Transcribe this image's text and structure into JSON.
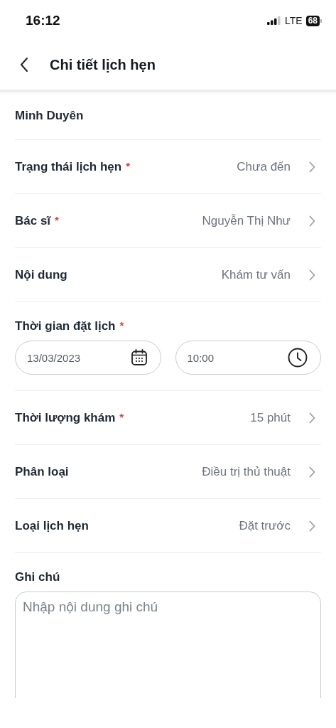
{
  "status_bar": {
    "time": "16:12",
    "network": "LTE",
    "battery": "68"
  },
  "header": {
    "title": "Chi tiết lịch hẹn"
  },
  "fields": [
    {
      "kind": "name",
      "label": "Minh Duyên"
    },
    {
      "kind": "select",
      "label": "Trạng thái lịch hẹn",
      "required_mark": "*",
      "value": "Chưa đến"
    },
    {
      "kind": "select",
      "label": "Bác sĩ",
      "required_mark": "*",
      "value": "Nguyễn Thị Như"
    },
    {
      "kind": "select",
      "label": "Nội dung",
      "value": "Khám tư vấn"
    },
    {
      "kind": "datetime",
      "label": "Thời gian đặt lịch",
      "required_mark": "*",
      "date": "13/03/2023",
      "time": "10:00"
    },
    {
      "kind": "select",
      "label": "Thời lượng khám",
      "required_mark": "*",
      "value": "15 phút"
    },
    {
      "kind": "select",
      "label": "Phân loại",
      "value": "Điều trị thủ thuật"
    },
    {
      "kind": "select",
      "label": "Loại lịch hẹn",
      "value": "Đặt trước"
    },
    {
      "kind": "note",
      "label": "Ghi chú",
      "placeholder": "Nhập nội dung ghi chú"
    }
  ]
}
